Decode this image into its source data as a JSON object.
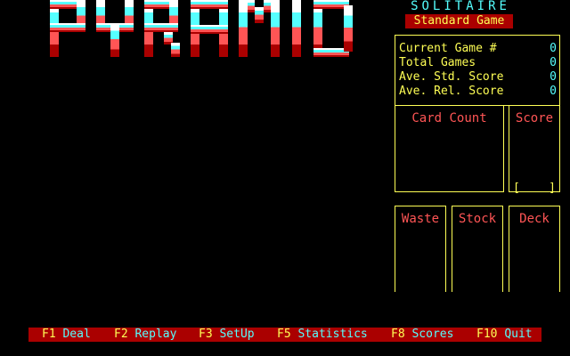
{
  "title": "PYRAMID",
  "subtitle": "SOLITAIRE",
  "mode": "Standard Game",
  "stats": [
    {
      "label": "Current Game #",
      "value": "0"
    },
    {
      "label": "Total Games",
      "value": "0"
    },
    {
      "label": "Ave. Std. Score",
      "value": "0"
    },
    {
      "label": "Ave. Rel. Score",
      "value": "0"
    }
  ],
  "panels": {
    "card_count": "Card Count",
    "score": "Score",
    "score_bracket_left": "[",
    "score_bracket_right": "]",
    "waste": "Waste",
    "stock": "Stock",
    "deck": "Deck",
    "bracket_left": "[",
    "bracket_right": "]"
  },
  "menu": [
    {
      "key": "F1",
      "label": "Deal"
    },
    {
      "key": "F2",
      "label": "Replay"
    },
    {
      "key": "F3",
      "label": "SetUp"
    },
    {
      "key": "F5",
      "label": "Statistics"
    },
    {
      "key": "F8",
      "label": "Scores"
    },
    {
      "key": "F10",
      "label": "Quit"
    }
  ],
  "colors": {
    "logo_top": "#ffffff",
    "logo_mid": "#55ffff",
    "logo_low": "#ff5555",
    "logo_bottom": "#aa0000",
    "frame": "#ffff55",
    "menu_bar": "#aa0000"
  }
}
